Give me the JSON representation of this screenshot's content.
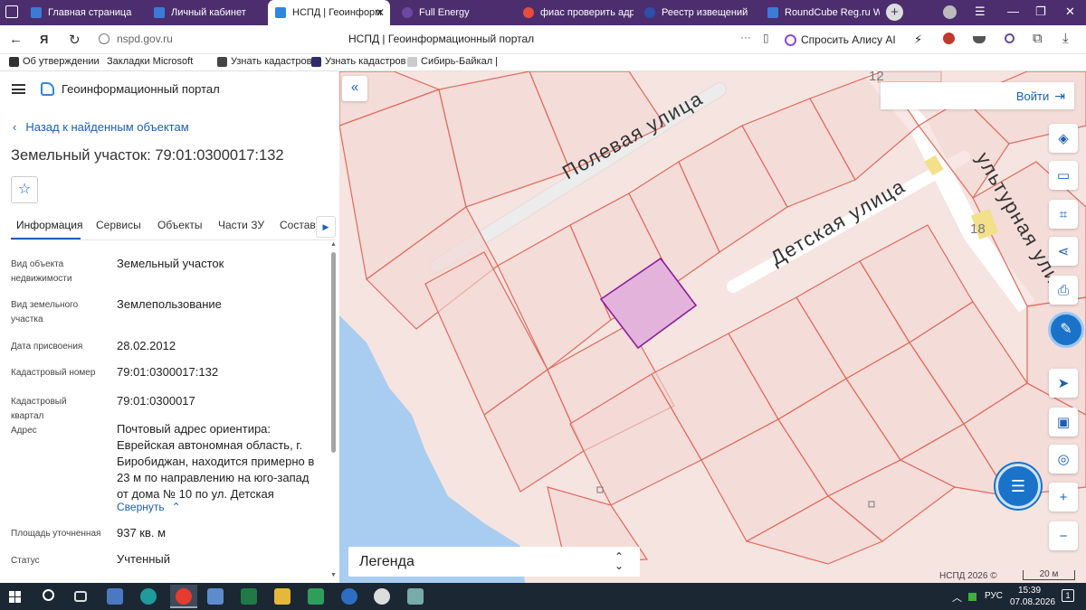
{
  "browser": {
    "tabs": [
      {
        "label": "Главная страница",
        "color": "#3a7bd5"
      },
      {
        "label": "Личный кабинет",
        "color": "#3a7bd5"
      },
      {
        "label": "НСПД | Геоинформ",
        "color": "#2e86de"
      },
      {
        "label": "Full Energy",
        "color": "#6a4aa0"
      },
      {
        "label": "фиас проверить адре",
        "color": "#e74c3c"
      },
      {
        "label": "Реестр извещений",
        "color": "#2d4fa8"
      },
      {
        "label": "RoundCube Reg.ru We",
        "color": "#3a7bd5"
      }
    ],
    "url": "nspd.gov.ru",
    "page_title": "НСПД | Геоинформационный портал",
    "alice_label": "Спросить Алису AI",
    "bookmarks": [
      {
        "label": "Об утверждении",
        "color": "#333333"
      },
      {
        "label": "Закладки Microsoft",
        "color": "#f2c200"
      },
      {
        "label": "Узнать кадастров",
        "color": "#444444"
      },
      {
        "label": "Узнать кадастров",
        "color": "#2c2c6c"
      },
      {
        "label": "Сибирь-Байкал |",
        "color": "#aaaaaa"
      }
    ]
  },
  "header": {
    "title": "Геоинформационный портал"
  },
  "panel": {
    "back_label": "Назад к найденным объектам",
    "title": "Земельный участок: 79:01:0300017:132",
    "tabs": [
      "Информация",
      "Сервисы",
      "Объекты",
      "Части ЗУ",
      "Состав"
    ],
    "properties": [
      {
        "label": "Вид объекта недвижимости",
        "value": "Земельный участок"
      },
      {
        "label": "Вид земельного участка",
        "value": "Землепользование"
      },
      {
        "label": "Дата присвоения",
        "value": "28.02.2012"
      },
      {
        "label": "Кадастровый номер",
        "value": "79:01:0300017:132"
      },
      {
        "label": "Кадастровый квартал",
        "value": "79:01:0300017"
      },
      {
        "label": "Адрес",
        "value": "Почтовый адрес ориентира: Еврейская автономная область, г. Биробиджан, находится примерно в 23 м по направлению на юго-запад от дома № 10 по ул. Детская"
      },
      {
        "label": "Площадь уточненная",
        "value": "937 кв. м"
      },
      {
        "label": "Статус",
        "value": "Учтенный"
      }
    ],
    "collapse_label": "Свернуть"
  },
  "map": {
    "login_label": "Войти",
    "streets": [
      "Полевая улица",
      "Детская улица",
      "ультурная ули"
    ],
    "house_numbers": [
      "12",
      "18"
    ],
    "legend_label": "Легенда",
    "copyright": "НСПД 2026 ©",
    "scale_label": "20 м",
    "colors": {
      "parcel_fill": "#f4d7d4",
      "parcel_line": "#e06a5a",
      "selected_fill": "#e3b3dc",
      "selected_line": "#8e1e9a",
      "water": "#a9cdf0"
    }
  },
  "taskbar": {
    "lang": "РУС",
    "time": "15:39",
    "date": "07.08.2026",
    "notifications": "1"
  }
}
